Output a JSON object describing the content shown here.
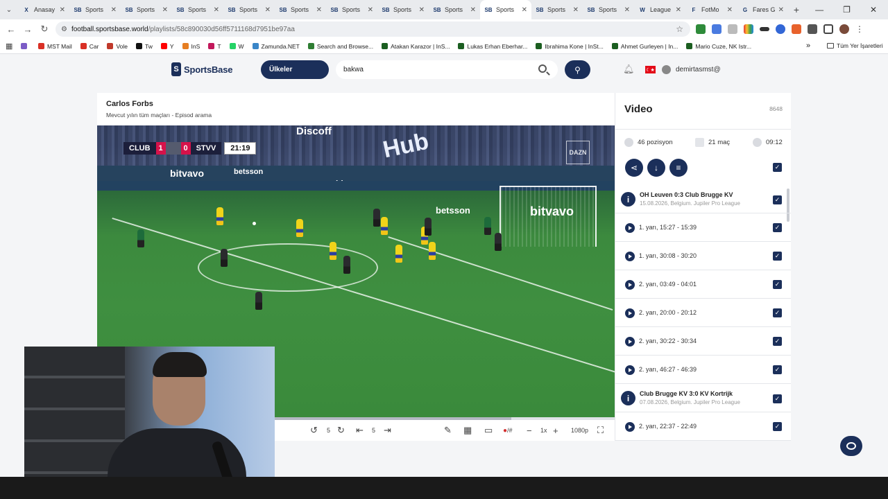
{
  "browser": {
    "tabs": [
      {
        "favicon": "X",
        "title": "Anasay"
      },
      {
        "favicon": "SB",
        "title": "Sports"
      },
      {
        "favicon": "SB",
        "title": "Sports"
      },
      {
        "favicon": "SB",
        "title": "Sports"
      },
      {
        "favicon": "SB",
        "title": "Sports"
      },
      {
        "favicon": "SB",
        "title": "Sports"
      },
      {
        "favicon": "SB",
        "title": "Sports"
      },
      {
        "favicon": "SB",
        "title": "Sports"
      },
      {
        "favicon": "SB",
        "title": "Sports"
      },
      {
        "favicon": "SB",
        "title": "Sports"
      },
      {
        "favicon": "SB",
        "title": "Sports"
      },
      {
        "favicon": "SB",
        "title": "Sports"
      },
      {
        "favicon": "W",
        "title": "League"
      },
      {
        "favicon": "F",
        "title": "FotMo"
      },
      {
        "favicon": "G",
        "title": "Fares G"
      }
    ],
    "active_tab": 9,
    "url_host": "football.sportsbase.world",
    "url_path": "/playlists/58c890030d56ff5711168d7951be97aa",
    "bookmarks": [
      {
        "label": "",
        "color": "#7b5cc6"
      },
      {
        "label": "MST Mail",
        "color": "#d93025"
      },
      {
        "label": "Car",
        "color": "#d93025"
      },
      {
        "label": "Vole",
        "color": "#c0392b"
      },
      {
        "label": "Tw",
        "color": "#111111"
      },
      {
        "label": "Y",
        "color": "#ff0000"
      },
      {
        "label": "InS",
        "color": "#e67e22"
      },
      {
        "label": "T",
        "color": "#c2185b"
      },
      {
        "label": "W",
        "color": "#25d366"
      },
      {
        "label": "Zamunda.NET",
        "color": "#3a86c8"
      },
      {
        "label": "Search and Browse...",
        "color": "#2e7d32"
      },
      {
        "label": "Atakan Karazor | InS...",
        "color": "#1b5e20"
      },
      {
        "label": "Lukas Erhan Eberhar...",
        "color": "#1b5e20"
      },
      {
        "label": "Ibrahima Kone | InSt...",
        "color": "#1b5e20"
      },
      {
        "label": "Ahmet Gurleyen | In...",
        "color": "#1b5e20"
      },
      {
        "label": "Mario Cuze, NK Istr...",
        "color": "#1b5e20"
      }
    ],
    "bookmarks_more": "»",
    "all_bookmarks": "Tüm Yer İşaretleri"
  },
  "app": {
    "logo_text": "SportsBase",
    "logo_letter": "S",
    "countries_button": "Ülkeler",
    "search_value": "bakwa",
    "username": "demirtasmst@",
    "flag_mark": "☾★"
  },
  "player": {
    "title": "Carlos Forbs",
    "subtitle": "Mevcut yılın tüm maçları - Episod arama",
    "progress": 0.8,
    "scorebug": {
      "home": "CLUB",
      "home_score": "1",
      "away_score": "0",
      "away": "STVV",
      "clock": "21:19"
    },
    "broadcaster": "DAZN",
    "ads": [
      "Discoff",
      "bitvavo",
      "betsson",
      "bitvavo",
      "betsson",
      "bitvavo",
      "Hub"
    ],
    "controls": {
      "skip_back": "5",
      "step": "5",
      "speed": "1x",
      "quality": "1080p"
    }
  },
  "panel": {
    "title": "Video",
    "count": "8648",
    "stats": {
      "positions": "46 pozisyon",
      "matches": "21 maç",
      "duration": "09:12"
    },
    "matches": [
      {
        "name": "OH Leuven 0:3 Club Brugge KV",
        "meta": "15.08.2026, Belgium. Jupiler Pro League",
        "clips": [
          "1. yarı, 15:27 - 15:39",
          "1. yarı, 30:08 - 30:20",
          "2. yarı, 03:49 - 04:01",
          "2. yarı, 20:00 - 20:12",
          "2. yarı, 30:22 - 30:34",
          "2. yarı, 46:27 - 46:39"
        ]
      },
      {
        "name": "Club Brugge KV 3:0 KV Kortrijk",
        "meta": "07.08.2026, Belgium. Jupiler Pro League",
        "clips": [
          "2. yarı, 22:37 - 22:49"
        ]
      }
    ]
  }
}
